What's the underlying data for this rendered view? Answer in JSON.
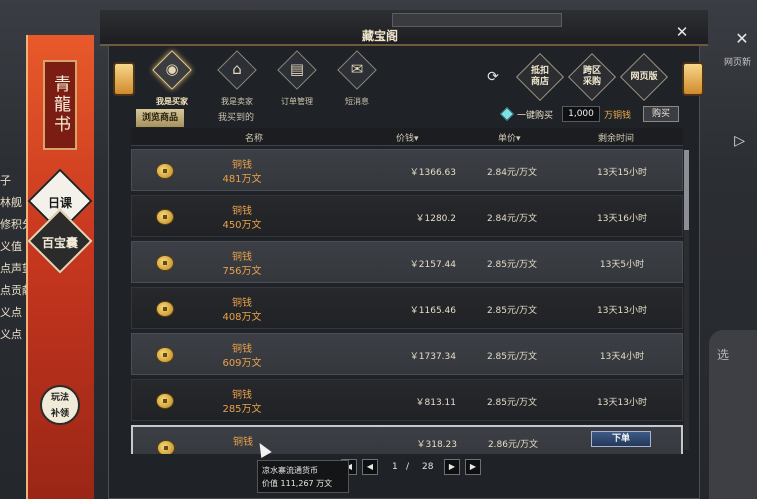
{
  "background": {
    "left_list": [
      "子",
      "林舰",
      "修积分",
      "义值",
      "点声望",
      "点贡献",
      "义点",
      "义点"
    ],
    "right_label": "网页新",
    "right_panel_label": "选"
  },
  "banner": {
    "title": "青龍书",
    "badge1": "日课",
    "badge2": "百宝囊",
    "play_button": "玩法\n补领"
  },
  "dialog": {
    "title": "藏宝阁"
  },
  "nav": {
    "items": [
      {
        "label": "我是买家",
        "glyph": "◉"
      },
      {
        "label": "我是卖家",
        "glyph": "⌂"
      },
      {
        "label": "订单管理",
        "glyph": "▤"
      },
      {
        "label": "短消息",
        "glyph": "✉"
      }
    ],
    "right_buttons": [
      {
        "label": "抵扣\n商店"
      },
      {
        "label": "跨区\n采购"
      },
      {
        "label": "网页版"
      }
    ]
  },
  "tabs": {
    "browse": "浏览商品",
    "bought": "我买到的"
  },
  "quick_buy": {
    "label": "一键购买",
    "value": "1,000",
    "unit": "万铜钱",
    "button": "购买"
  },
  "table": {
    "headers": {
      "name": "名称",
      "price": "价钱",
      "unit_price": "单价",
      "time_left": "剩余时间"
    },
    "rows": [
      {
        "item": "铜钱",
        "amount": "481万文",
        "price": "￥1366.63",
        "unit_price": "2.84元/万文",
        "time_left": "13天15小时"
      },
      {
        "item": "铜钱",
        "amount": "450万文",
        "price": "￥1280.2",
        "unit_price": "2.84元/万文",
        "time_left": "13天16小时"
      },
      {
        "item": "铜钱",
        "amount": "756万文",
        "price": "￥2157.44",
        "unit_price": "2.85元/万文",
        "time_left": "13天5小时"
      },
      {
        "item": "铜钱",
        "amount": "408万文",
        "price": "￥1165.46",
        "unit_price": "2.85元/万文",
        "time_left": "13天13小时"
      },
      {
        "item": "铜钱",
        "amount": "609万文",
        "price": "￥1737.34",
        "unit_price": "2.85元/万文",
        "time_left": "13天4小时"
      },
      {
        "item": "铜钱",
        "amount": "285万文",
        "price": "￥813.11",
        "unit_price": "2.85元/万文",
        "time_left": "13天13小时"
      },
      {
        "item": "铜钱",
        "amount": "",
        "price": "￥318.23",
        "unit_price": "2.86元/万文",
        "time_left": "",
        "action": "下单"
      }
    ]
  },
  "pagination": {
    "current": "1",
    "separator": "/",
    "total": "28"
  },
  "tooltip": {
    "line1": "凉水寨流通货币",
    "line2": "价值  111,267  万文"
  }
}
